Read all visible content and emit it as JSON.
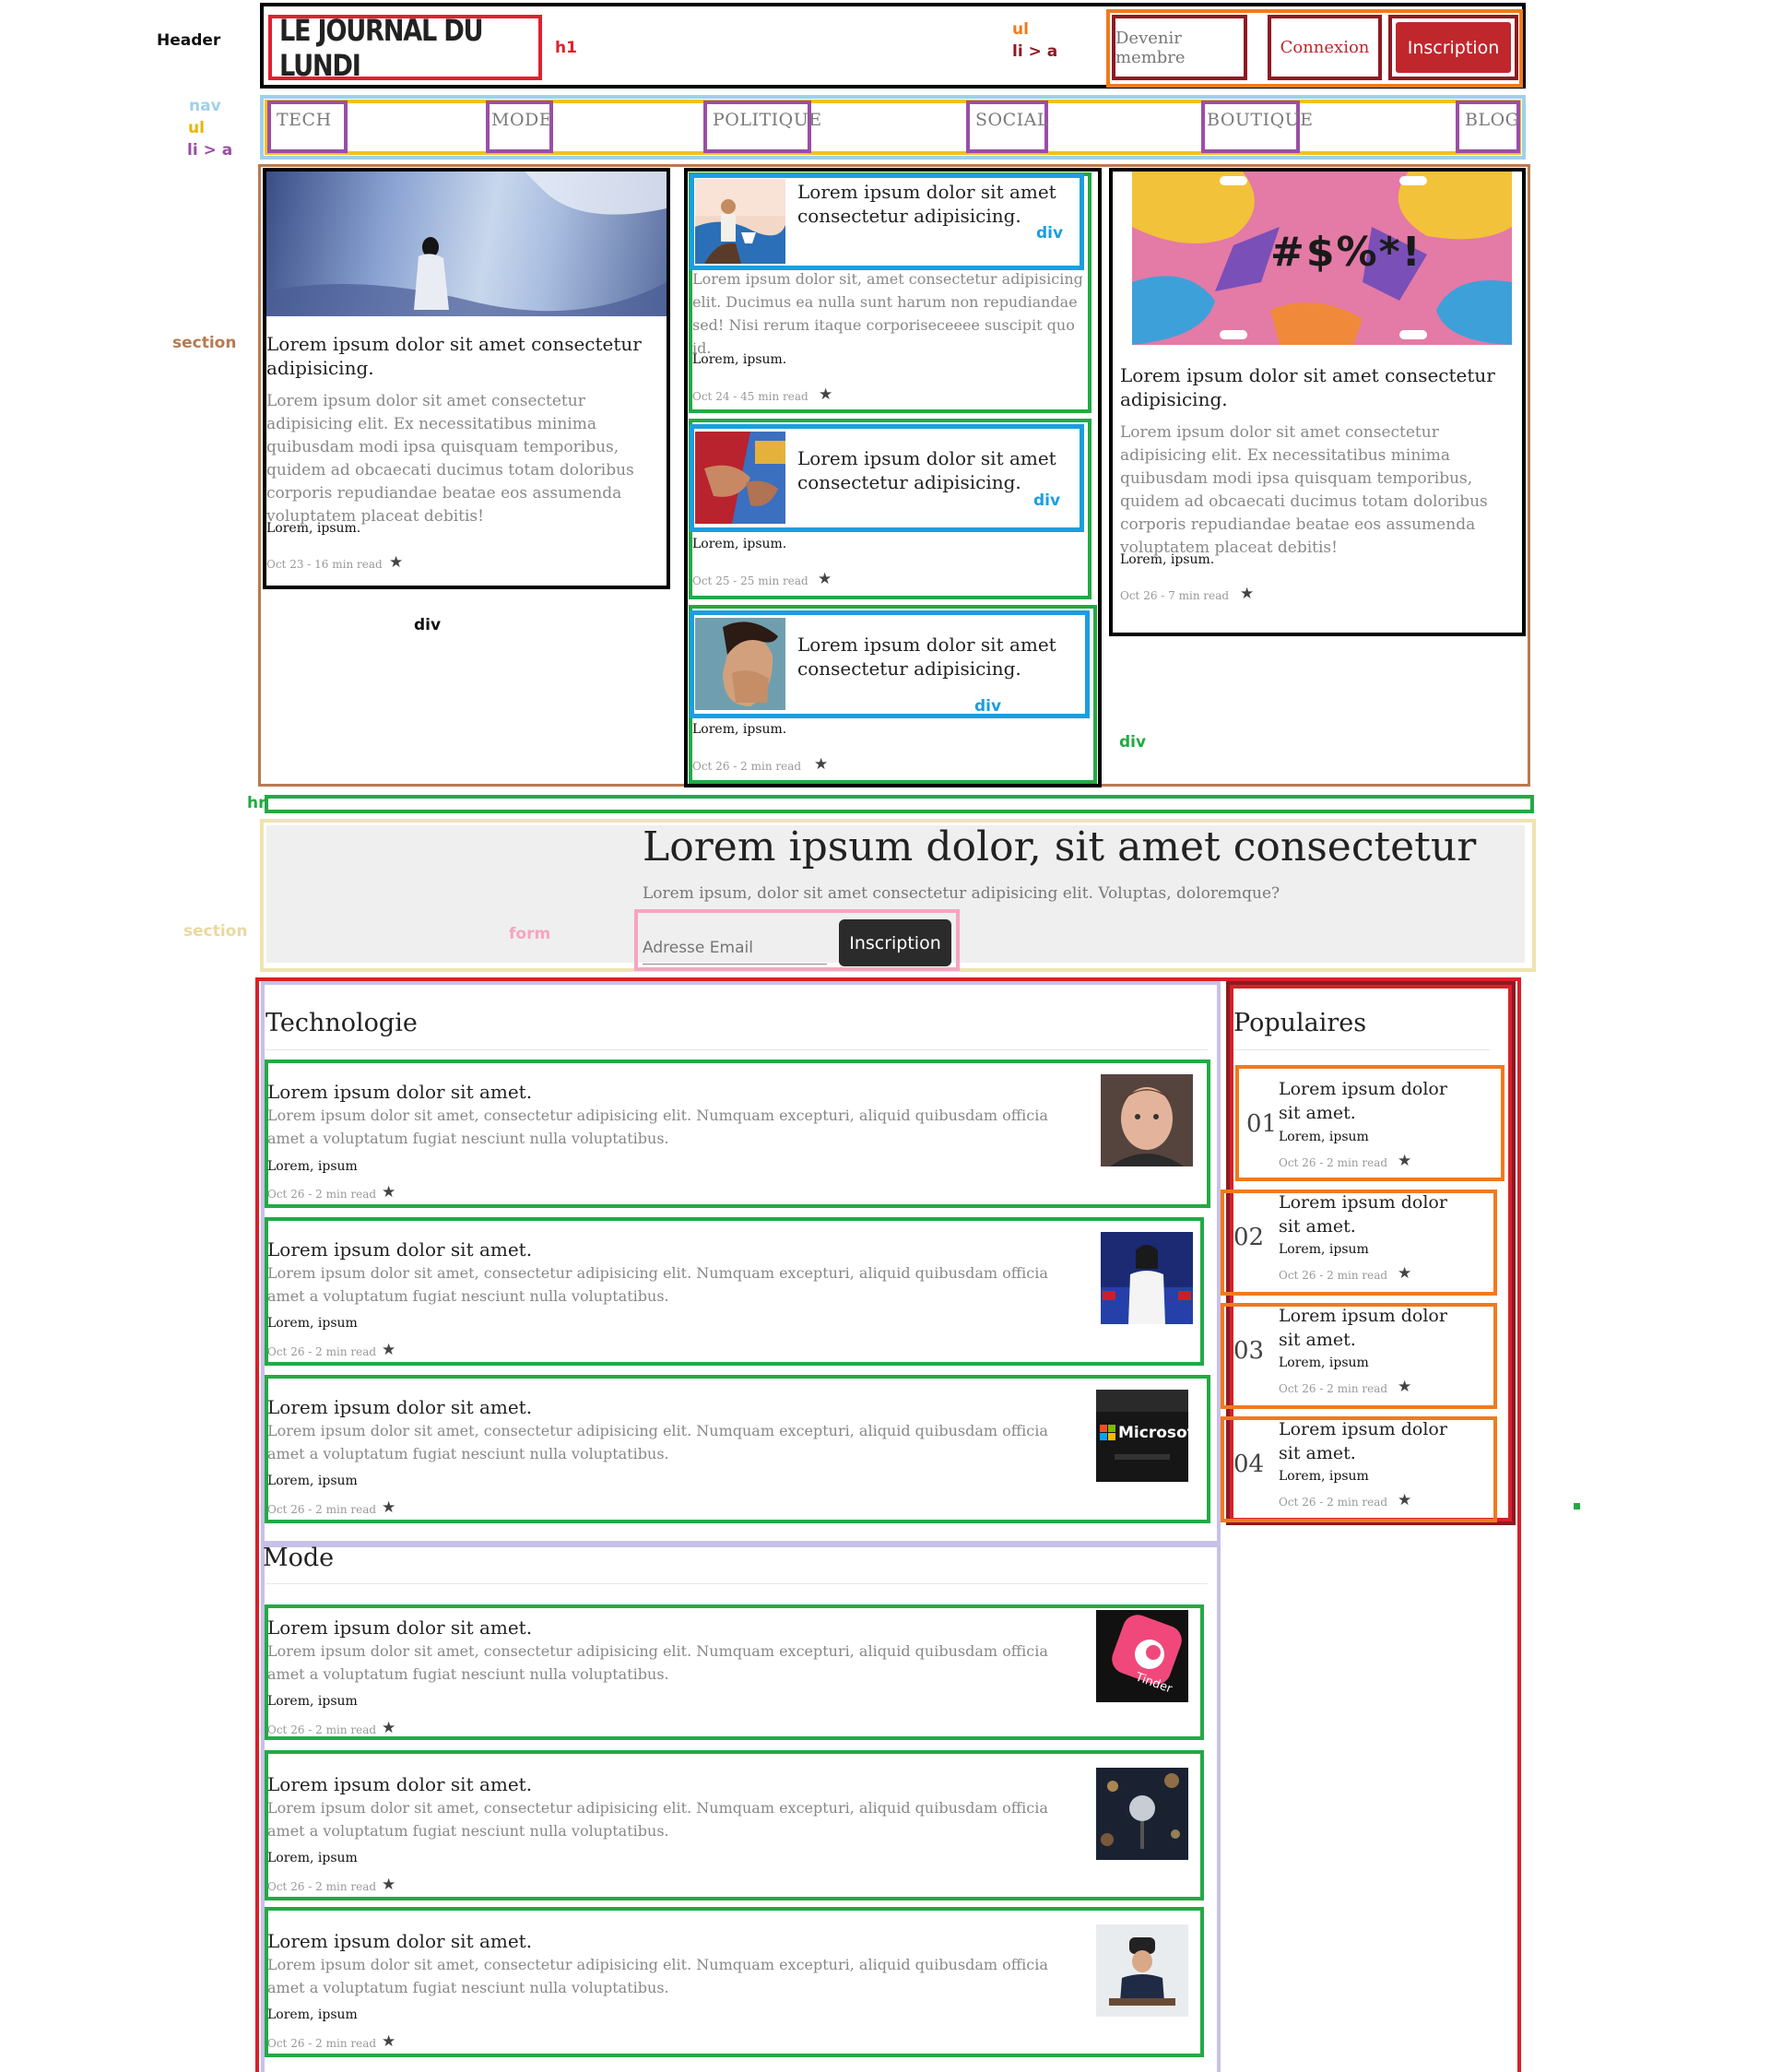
{
  "annotations": {
    "header": "Header",
    "h1": "h1",
    "ul": "ul",
    "li_a": "li > a",
    "nav": "nav",
    "nav_ul": "ul",
    "nav_li_a": "li > a",
    "section": "section",
    "div": "div",
    "hr": "hr",
    "section2": "section",
    "form": "form"
  },
  "header": {
    "logo": "LE JOURNAL DU LUNDI",
    "buttons": [
      "Devenir membre",
      "Connexion",
      "Inscription"
    ]
  },
  "nav": {
    "items": [
      "TECH",
      "MODE",
      "POLITIQUE",
      "SOCIAL",
      "BOUTIQUE",
      "BLOG"
    ]
  },
  "hero": {
    "left": {
      "title": "Lorem ipsum dolor sit amet consectetur adipisicing.",
      "excerpt": "Lorem ipsum dolor sit amet consectetur adipisicing elit. Ex necessitatibus minima quibusdam modi ipsa quisquam temporibus, quidem ad obcaecati ducimus totam doloribus corporis repudiandae beatae eos assumenda voluptatem placeat debitis!",
      "author": "Lorem, ipsum.",
      "meta": "Oct 23 - 16 min read"
    },
    "middle": [
      {
        "title": "Lorem ipsum dolor sit amet consectetur adipisicing.",
        "excerpt": "Lorem ipsum dolor sit, amet consectetur adipisicing elit. Ducimus ea nulla sunt harum non repudiandae sed! Nisi rerum itaque corporiseceeee suscipit quo id.",
        "author": "Lorem, ipsum.",
        "meta": "Oct 24 - 45 min read"
      },
      {
        "title": "Lorem ipsum dolor sit amet consectetur adipisicing.",
        "author": "Lorem, ipsum.",
        "meta": "Oct 25 - 25 min read"
      },
      {
        "title": "Lorem ipsum dolor sit amet consectetur adipisicing.",
        "author": "Lorem, ipsum.",
        "meta": "Oct 26 - 2 min read"
      }
    ],
    "right": {
      "title": "Lorem ipsum dolor sit amet consectetur adipisicing.",
      "excerpt": "Lorem ipsum dolor sit amet consectetur adipisicing elit. Ex necessitatibus minima quibusdam modi ipsa quisquam temporibus, quidem ad obcaecati ducimus totam doloribus corporis repudiandae beatae eos assumenda voluptatem placeat debitis!",
      "author": "Lorem, ipsum.",
      "meta": "Oct 26 - 7 min read",
      "image_text": "#$%*!"
    }
  },
  "newsletter": {
    "heading": "Lorem ipsum dolor, sit amet consectetur",
    "subheading": "Lorem ipsum, dolor sit amet consectetur adipisicing elit. Voluptas, doloremque?",
    "email_placeholder": "Adresse Email",
    "submit_label": "Inscription"
  },
  "technologie": {
    "heading": "Technologie",
    "articles": [
      {
        "title": "Lorem ipsum dolor sit amet.",
        "excerpt": "Lorem ipsum dolor sit amet, consectetur adipisicing elit. Numquam excepturi, aliquid quibusdam officia amet a voluptatum fugiat nesciunt nulla voluptatibus.",
        "author": "Lorem, ipsum",
        "meta": "Oct 26 - 2 min read"
      },
      {
        "title": "Lorem ipsum dolor sit amet.",
        "excerpt": "Lorem ipsum dolor sit amet, consectetur adipisicing elit. Numquam excepturi, aliquid quibusdam officia amet a voluptatum fugiat nesciunt nulla voluptatibus.",
        "author": "Lorem, ipsum",
        "meta": "Oct 26 - 2 min read"
      },
      {
        "title": "Lorem ipsum dolor sit amet.",
        "excerpt": "Lorem ipsum dolor sit amet, consectetur adipisicing elit. Numquam excepturi, aliquid quibusdam officia amet a voluptatum fugiat nesciunt nulla voluptatibus.",
        "author": "Lorem, ipsum",
        "meta": "Oct 26 - 2 min read",
        "image_text": "Microsoft"
      }
    ]
  },
  "mode": {
    "heading": "Mode",
    "articles": [
      {
        "title": "Lorem ipsum dolor sit amet.",
        "excerpt": "Lorem ipsum dolor sit amet, consectetur adipisicing elit. Numquam excepturi, aliquid quibusdam officia amet a voluptatum fugiat nesciunt nulla voluptatibus.",
        "author": "Lorem, ipsum",
        "meta": "Oct 26 - 2 min read",
        "image_text": "Tinder"
      },
      {
        "title": "Lorem ipsum dolor sit amet.",
        "excerpt": "Lorem ipsum dolor sit amet, consectetur adipisicing elit. Numquam excepturi, aliquid quibusdam officia amet a voluptatum fugiat nesciunt nulla voluptatibus.",
        "author": "Lorem, ipsum",
        "meta": "Oct 26 - 2 min read"
      },
      {
        "title": "Lorem ipsum dolor sit amet.",
        "excerpt": "Lorem ipsum dolor sit amet, consectetur adipisicing elit. Numquam excepturi, aliquid quibusdam officia amet a voluptatum fugiat nesciunt nulla voluptatibus.",
        "author": "Lorem, ipsum",
        "meta": "Oct 26 - 2 min read"
      }
    ]
  },
  "populaires": {
    "heading": "Populaires",
    "items": [
      {
        "num": "01",
        "title": "Lorem ipsum dolor sit amet.",
        "author": "Lorem, ipsum",
        "meta": "Oct 26 - 2 min read"
      },
      {
        "num": "02",
        "title": "Lorem ipsum dolor sit amet.",
        "author": "Lorem, ipsum",
        "meta": "Oct 26 - 2 min read"
      },
      {
        "num": "03",
        "title": "Lorem ipsum dolor sit amet.",
        "author": "Lorem, ipsum",
        "meta": "Oct 26 - 2 min read"
      },
      {
        "num": "04",
        "title": "Lorem ipsum dolor sit amet.",
        "author": "Lorem, ipsum",
        "meta": "Oct 26 - 2 min read"
      }
    ]
  },
  "icons": {
    "star": "star-icon"
  },
  "colors": {
    "header_outline": "#000000",
    "h1_outline": "#e0202e",
    "ul_outline": "#f07a1e",
    "li_a_outline": "#8e1a22",
    "nav_outline": "#9fd0ea",
    "nav_ul_outline": "#f2c11a",
    "nav_li_a_outline": "#9b4ea6",
    "section_outline": "#b87a52",
    "div_blue": "#1a9ee0",
    "div_green": "#22aa44",
    "form_outline": "#f5a5c0",
    "section2_outline": "#f0e3b0",
    "content_outline": "#d8202a",
    "category_outline": "#c8c0e8",
    "popular_outline": "#8e1a22",
    "popular_item_outline": "#f07a1e",
    "accent_red": "#c0272d",
    "button_dark": "#2b2b2b"
  }
}
